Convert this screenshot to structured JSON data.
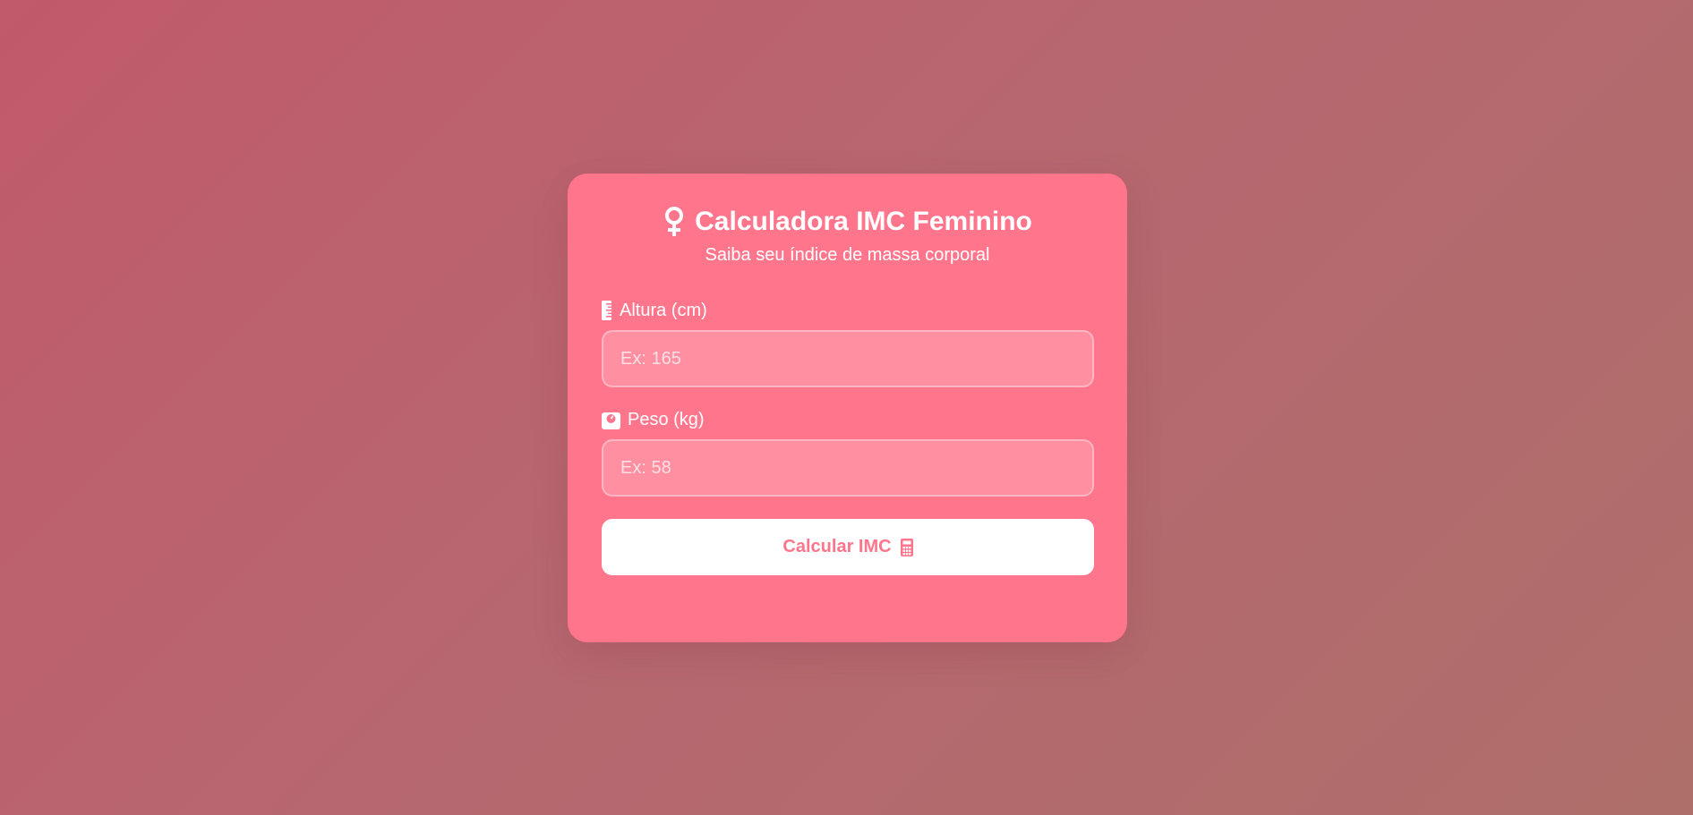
{
  "header": {
    "icon": "female-sign-icon",
    "title": "Calculadora IMC Feminino",
    "subtitle": "Saiba seu índice de massa corporal"
  },
  "form": {
    "height": {
      "icon": "ruler-icon",
      "label": "Altura (cm)",
      "placeholder": "Ex: 165",
      "value": ""
    },
    "weight": {
      "icon": "weight-scale-icon",
      "label": "Peso (kg)",
      "placeholder": "Ex: 58",
      "value": ""
    },
    "submit": {
      "label": "Calcular IMC",
      "icon": "calculator-icon"
    }
  },
  "colors": {
    "card": "#ff758c",
    "input_bg": "#ff8fa1",
    "button_bg": "#ffffff",
    "button_text": "#ff758c",
    "background_start": "#c15a6b",
    "background_end": "#ae6e6a"
  }
}
